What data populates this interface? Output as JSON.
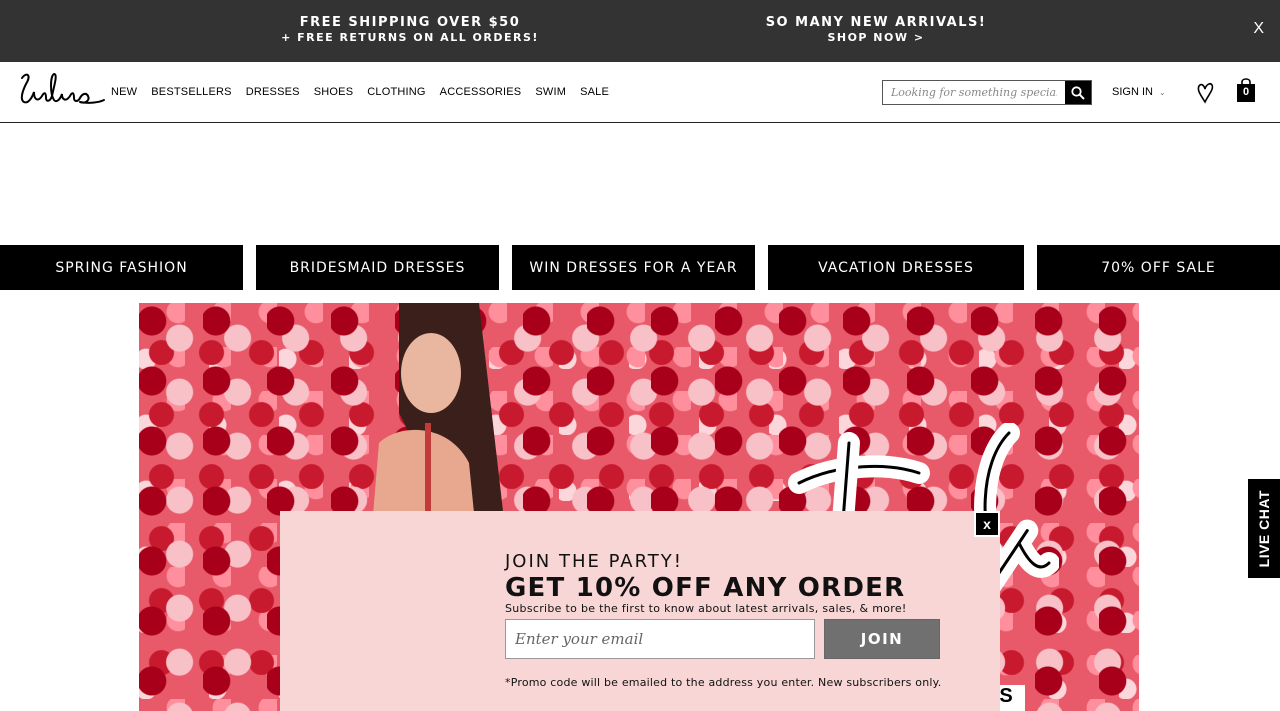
{
  "promo_bar": {
    "left": {
      "line1": "FREE SHIPPING OVER $50",
      "line2": "+ FREE RETURNS ON ALL ORDERS!"
    },
    "right": {
      "line1": "SO MANY NEW ARRIVALS!",
      "line2": "SHOP NOW >"
    },
    "close_label": "X"
  },
  "header": {
    "logo": "Lulus",
    "nav": [
      "NEW",
      "BESTSELLERS",
      "DRESSES",
      "SHOES",
      "CLOTHING",
      "ACCESSORIES",
      "SWIM",
      "SALE"
    ],
    "search_placeholder": "Looking for something special?",
    "signin_label": "SIGN IN",
    "cart_count": "0"
  },
  "categories": [
    "SPRING FASHION",
    "BRIDESMAID DRESSES",
    "WIN DRESSES FOR A YEAR",
    "VACATION DRESSES",
    "70% OFF SALE"
  ],
  "hero": {
    "corner_text": "S"
  },
  "modal": {
    "close_label": "x",
    "kicker": "JOIN THE PARTY!",
    "title": "GET 10% OFF ANY ORDER",
    "subtitle": "Subscribe to be the first to know about latest arrivals, sales, & more!",
    "email_placeholder": "Enter your email",
    "join_label": "JOIN",
    "fine_print": "*Promo code will be emailed to the address you enter. New subscribers only."
  },
  "live_chat_label": "LIVE CHAT",
  "colors": {
    "promo_bg": "#333333",
    "modal_bg": "#f8d6d6",
    "join_bg": "#707070"
  }
}
